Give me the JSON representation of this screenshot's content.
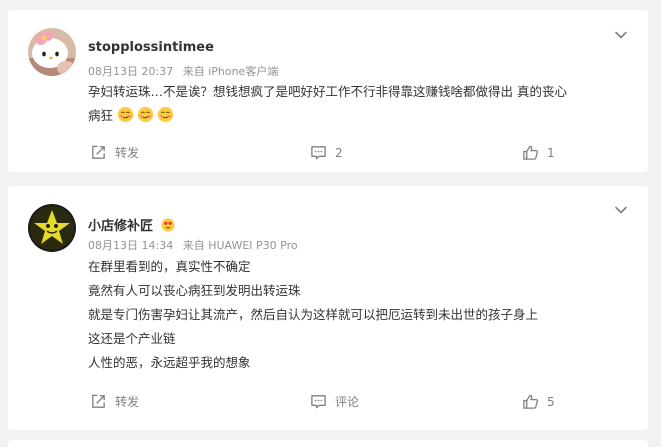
{
  "comments": [
    {
      "username": "stopplossintimee",
      "date": "08月13日 20:37",
      "source": "来自 iPhone客户端",
      "lines": [
        "孕妇转运珠…不是诶？想钱想疯了是吧好好工作不行非得靠这赚钱啥都做得出 真的丧心",
        "病狂"
      ],
      "emoji_icons": [
        "smirk-emoji-icon",
        "smirk-emoji-icon",
        "smirk-emoji-icon"
      ],
      "share_label": "转发",
      "comment_label": "2",
      "like_count": "1"
    },
    {
      "username": "小店修补匠",
      "date": "08月13日 14:34",
      "source": "来自 HUAWEI P30 Pro",
      "lines": [
        "在群里看到的，真实性不确定",
        "竟然有人可以丧心病狂到发明出转运珠",
        "就是专门伤害孕妇让其流产，然后自认为这样就可以把厄运转到未出世的孩子身上",
        "这还是个产业链",
        "人性的恶，永远超乎我的想象"
      ],
      "share_label": "转发",
      "comment_label": "评论",
      "like_count": "5"
    }
  ],
  "colors": {
    "background": "#f2f2f2",
    "card": "#ffffff",
    "text": "#333333",
    "meta": "#939393",
    "action": "#808080"
  }
}
